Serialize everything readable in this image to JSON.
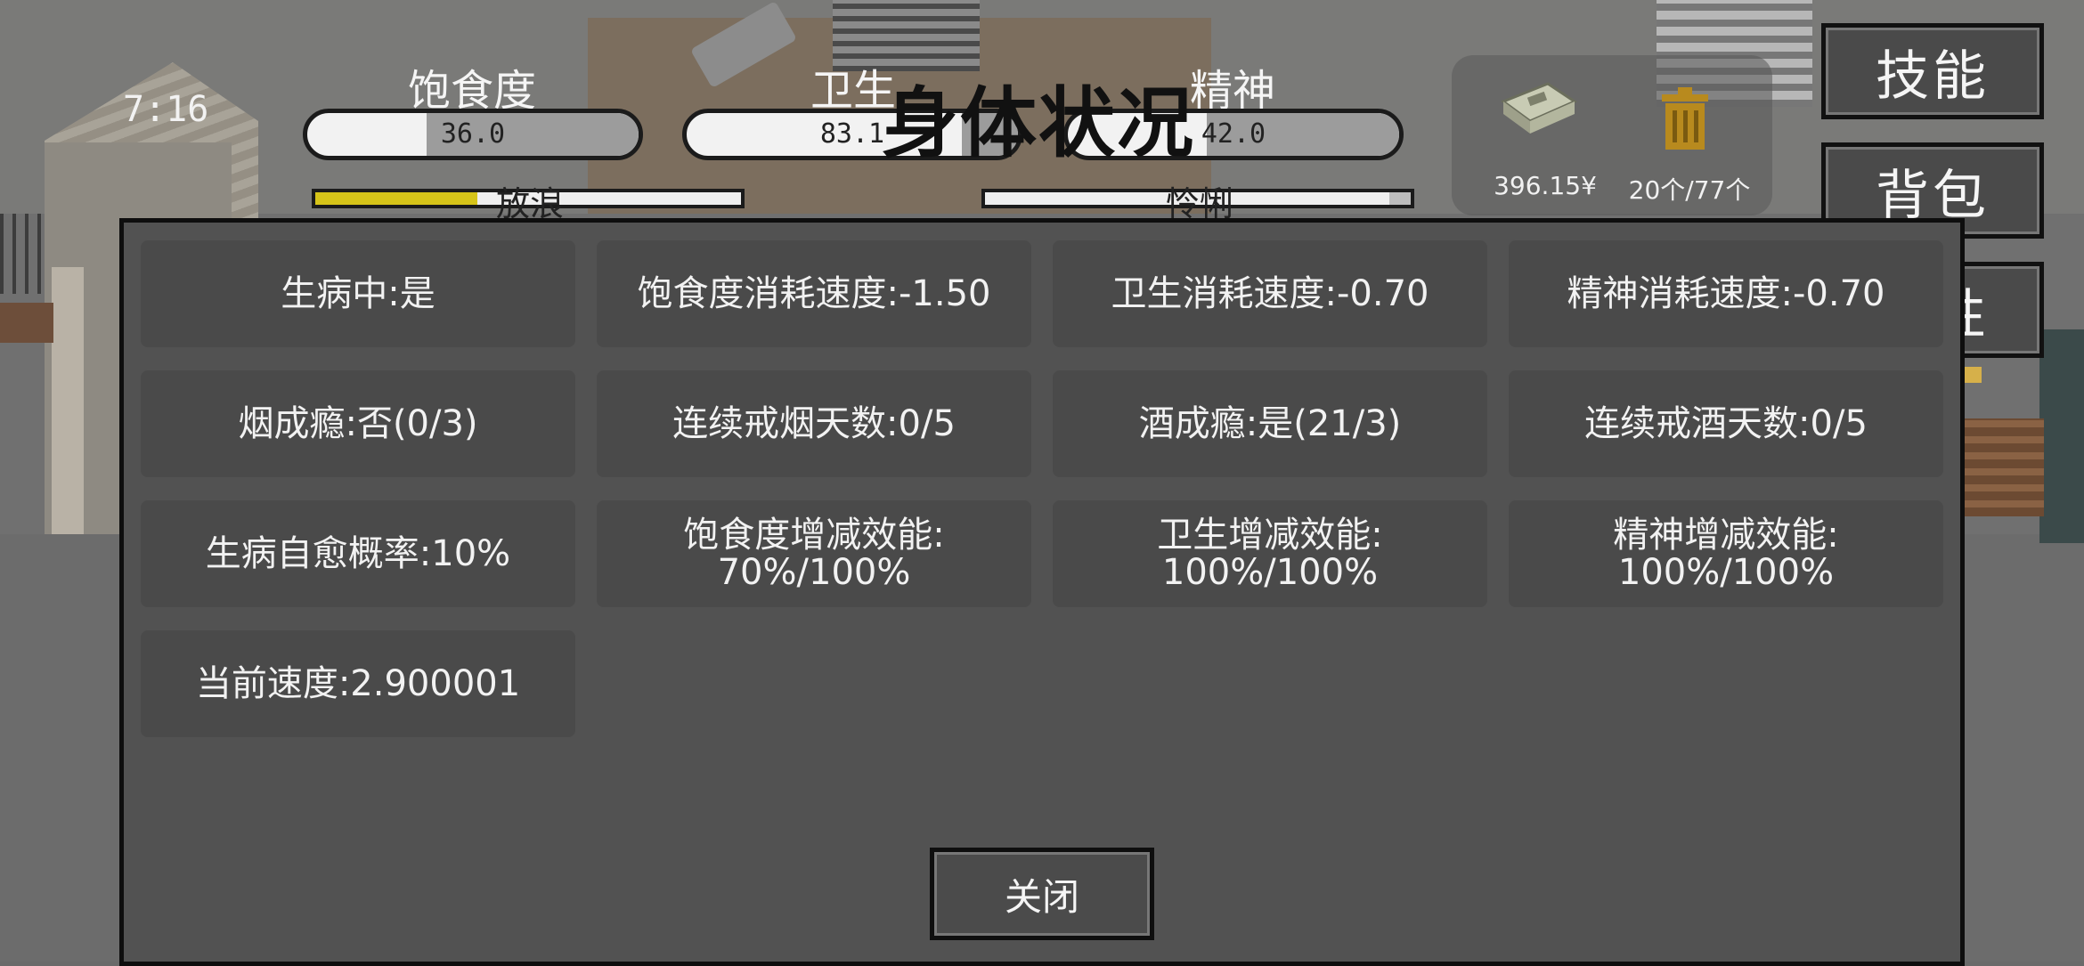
{
  "clock": "7:16",
  "stats": [
    {
      "label": "饱食度",
      "value": "36.0",
      "fraction": 0.36
    },
    {
      "label": "卫生",
      "value": "83.1",
      "fraction": 0.831
    },
    {
      "label": "精神",
      "value": "42.0",
      "fraction": 0.42
    }
  ],
  "sub_bars": [
    {
      "label": "放浪",
      "fraction": 0.38
    },
    {
      "label": "怜悧",
      "fraction": 0.95
    }
  ],
  "panel_title": "身体状况",
  "money": "396.15¥",
  "bag_capacity": "20个/77个",
  "side_buttons": {
    "skills": "技能",
    "backpack": "背包",
    "attributes": "属性"
  },
  "status_cells": [
    "生病中:是",
    "饱食度消耗速度:-1.50",
    "卫生消耗速度:-0.70",
    "精神消耗速度:-0.70",
    "烟成瘾:否(0/3)",
    "连续戒烟天数:0/5",
    "酒成瘾:是(21/3)",
    "连续戒酒天数:0/5",
    "生病自愈概率:10%",
    "饱食度增减效能:\n70%/100%",
    "卫生增减效能:\n100%/100%",
    "精神增减效能:\n100%/100%",
    "当前速度:2.900001"
  ],
  "close_label": "关闭",
  "colors": {
    "modal_bg": "#525252",
    "cell_bg": "#4a4a4a",
    "sub_bar_fill": "#d6c419"
  },
  "icons": {
    "money": "money-stack-icon",
    "bag": "trash-bin-icon"
  }
}
